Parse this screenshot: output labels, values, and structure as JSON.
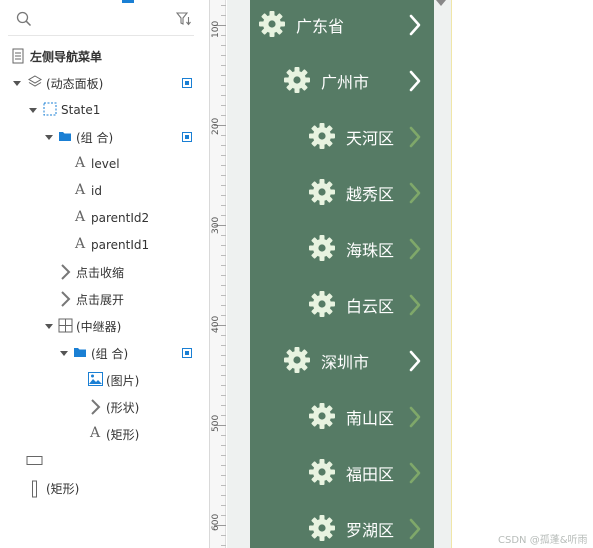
{
  "outline": {
    "rows": [
      {
        "label": "左侧导航菜单"
      },
      {
        "label": "(动态面板)"
      },
      {
        "label": "State1"
      },
      {
        "label": "(组 合)"
      },
      {
        "label": "level"
      },
      {
        "label": "id"
      },
      {
        "label": "parentId2"
      },
      {
        "label": "parentId1"
      },
      {
        "label": "点击收缩"
      },
      {
        "label": "点击展开"
      },
      {
        "label": "(中继器)"
      },
      {
        "label": "(组 合)"
      },
      {
        "label": "(图片)"
      },
      {
        "label": "(形状)"
      },
      {
        "label": "(矩形)"
      },
      {
        "label": ""
      },
      {
        "label": "(矩形)"
      }
    ]
  },
  "ruler": {
    "labels": [
      "100",
      "200",
      "300",
      "400",
      "500",
      "600"
    ]
  },
  "menu": {
    "colors": {
      "background": "#567b65",
      "gear": "#e8f3e0",
      "chevron_bright": "#ffffff",
      "chevron_dim": "#7fa86a"
    },
    "items": [
      {
        "label": "广东省",
        "level": 0
      },
      {
        "label": "广州市",
        "level": 1
      },
      {
        "label": "天河区",
        "level": 2
      },
      {
        "label": "越秀区",
        "level": 2
      },
      {
        "label": "海珠区",
        "level": 2
      },
      {
        "label": "白云区",
        "level": 2
      },
      {
        "label": "深圳市",
        "level": 1
      },
      {
        "label": "南山区",
        "level": 2
      },
      {
        "label": "福田区",
        "level": 2
      },
      {
        "label": "罗湖区",
        "level": 2
      }
    ]
  },
  "watermark": "CSDN @孤蓬&听雨"
}
